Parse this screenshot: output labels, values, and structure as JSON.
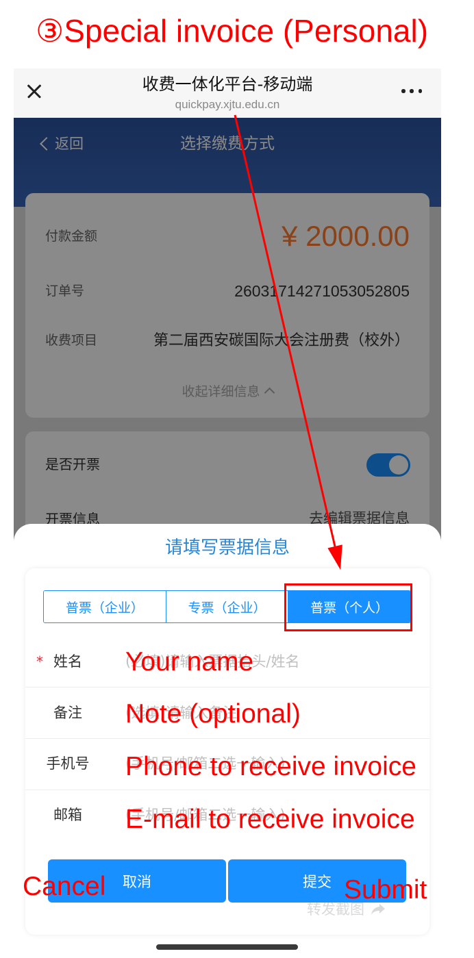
{
  "annotation": {
    "title": "③Special invoice (Personal)",
    "labels": {
      "name": "Your name",
      "note": "Note (optional)",
      "phone": "Phone to receive invoice",
      "email": "E-mail to receive invoice",
      "cancel": "Cancel",
      "submit": "Submit"
    }
  },
  "browser": {
    "title": "收费一体化平台-移动端",
    "url": "quickpay.xjtu.edu.cn",
    "close_icon": "close-icon",
    "menu_icon": "more-icon"
  },
  "header": {
    "back_icon": "chevron-left-icon",
    "back_label": "返回",
    "title": "选择缴费方式"
  },
  "payment": {
    "amount_label": "付款金额",
    "amount": "¥ 2000.00",
    "order_label": "订单号",
    "order_no": "26031714271053052805",
    "item_label": "收费项目",
    "item": "第二届西安碳国际大会注册费（校外）",
    "collapse_label": "收起详细信息",
    "collapse_icon": "chevron-up-icon"
  },
  "invoice": {
    "toggle_label": "是否开票",
    "toggle_on": true,
    "info_label": "开票信息",
    "info_action": "去编辑票据信息"
  },
  "sheet": {
    "title": "请填写票据信息",
    "tabs": [
      {
        "label": "普票（企业）"
      },
      {
        "label": "专票（企业）"
      },
      {
        "label": "普票（个人）"
      }
    ],
    "active_tab": 2,
    "required_mark": "*",
    "fields": [
      {
        "label": "姓名",
        "required": true,
        "placeholder": "(必填)请输入票据抬头/姓名"
      },
      {
        "label": "备注",
        "required": false,
        "placeholder": "(选填)请输入备注"
      },
      {
        "label": "手机号",
        "required": false,
        "placeholder": "(手机号/邮箱二选一输入)"
      },
      {
        "label": "邮箱",
        "required": false,
        "placeholder": "(手机号/邮箱二选一输入)"
      }
    ],
    "cancel_label": "取消",
    "submit_label": "提交"
  },
  "share": {
    "label": "转发截图",
    "icon": "share-icon"
  },
  "colors": {
    "accent": "#1890ff",
    "amount": "#ff7a2e",
    "header": "#3865b8",
    "sheet_title": "#2a86d6",
    "annotation": "#ff0000"
  }
}
